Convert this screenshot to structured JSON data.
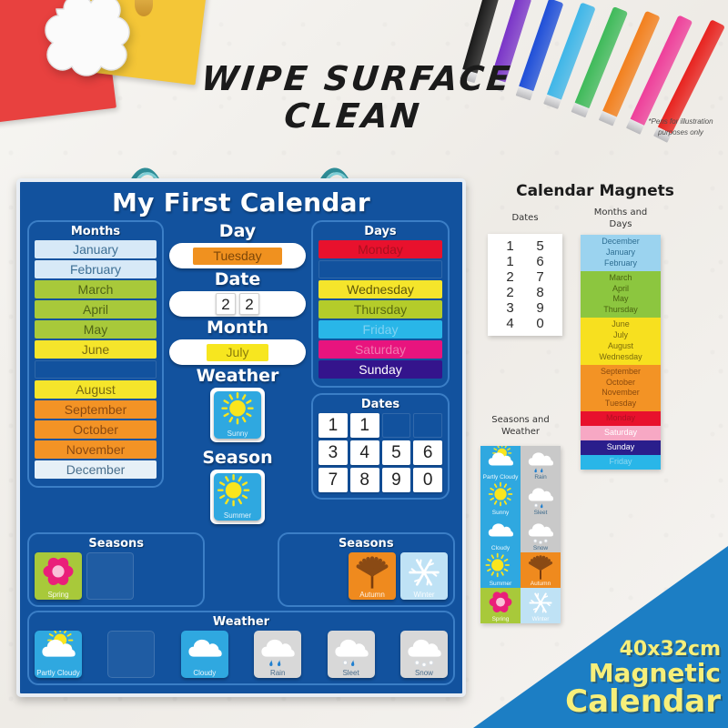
{
  "headline": {
    "line1": "WIPE SURFACE",
    "line2": "CLEAN"
  },
  "disclaimer": "*Pens for illustration purposes only",
  "pens": [
    {
      "name": "pen-black",
      "color": "#1a1a1a"
    },
    {
      "name": "pen-purple",
      "color": "#7a35c8"
    },
    {
      "name": "pen-blue",
      "color": "#1f4fd8"
    },
    {
      "name": "pen-cyan",
      "color": "#3fb6e8"
    },
    {
      "name": "pen-green",
      "color": "#3fba5a"
    },
    {
      "name": "pen-orange",
      "color": "#f2801e"
    },
    {
      "name": "pen-pink",
      "color": "#ee3f9a"
    },
    {
      "name": "pen-red",
      "color": "#e8231f"
    }
  ],
  "board": {
    "title": "My First Calendar",
    "months_panel": {
      "header": "Months",
      "tiles": [
        {
          "label": "January",
          "bg": "#d7e9f7",
          "fg": "#3e6f94"
        },
        {
          "label": "February",
          "bg": "#d7e9f7",
          "fg": "#3e6f94"
        },
        {
          "label": "March",
          "bg": "#a8c93a",
          "fg": "#4f6316"
        },
        {
          "label": "April",
          "bg": "#a8c93a",
          "fg": "#4f6316"
        },
        {
          "label": "May",
          "bg": "#a8c93a",
          "fg": "#4f6316"
        },
        {
          "label": "June",
          "bg": "#f5e52b",
          "fg": "#7a6b10"
        },
        {
          "label": "",
          "bg": "",
          "fg": ""
        },
        {
          "label": "August",
          "bg": "#f5e52b",
          "fg": "#7a6b10"
        },
        {
          "label": "September",
          "bg": "#f39325",
          "fg": "#8c4a10"
        },
        {
          "label": "October",
          "bg": "#f39325",
          "fg": "#8c4a10"
        },
        {
          "label": "November",
          "bg": "#f39325",
          "fg": "#8c4a10"
        },
        {
          "label": "December",
          "bg": "#e6f0f7",
          "fg": "#4a6f8c"
        }
      ]
    },
    "days_panel": {
      "header": "Days",
      "tiles": [
        {
          "label": "Monday",
          "bg": "#e8112d",
          "fg": "#a8101f"
        },
        {
          "label": "",
          "bg": "",
          "fg": ""
        },
        {
          "label": "Wednesday",
          "bg": "#f5e52b",
          "fg": "#5f5708"
        },
        {
          "label": "Thursday",
          "bg": "#b4cc2a",
          "fg": "#5a6a10"
        },
        {
          "label": "Friday",
          "bg": "#29b6e8",
          "fg": "#7fd2f2"
        },
        {
          "label": "Saturday",
          "bg": "#e8147e",
          "fg": "#f07ab0"
        },
        {
          "label": "Sunday",
          "bg": "#34148c",
          "fg": "#ffffff"
        }
      ]
    },
    "center": {
      "day_label": "Day",
      "day_value": "Tuesday",
      "day_bg": "#f0911f",
      "day_fg": "#7d4708",
      "date_label": "Date",
      "date_digits": [
        "2",
        "2"
      ],
      "month_label": "Month",
      "month_value": "July",
      "month_bg": "#f7e61f",
      "month_fg": "#8a7c0c",
      "weather_label": "Weather",
      "weather_value": "Sunny",
      "season_label": "Season",
      "season_value": "Summer"
    },
    "dates_panel": {
      "header": "Dates",
      "cells": [
        "1",
        "1",
        "",
        "",
        "3",
        "4",
        "5",
        "6",
        "7",
        "8",
        "9",
        "0"
      ]
    },
    "seasons_left": {
      "header": "Seasons",
      "tiles": [
        {
          "label": "Spring",
          "kind": "flower",
          "bg": "#a8c93a"
        },
        {
          "label": "",
          "kind": "empty",
          "bg": ""
        }
      ]
    },
    "seasons_right": {
      "header": "Seasons",
      "tiles": [
        {
          "label": "Autumn",
          "kind": "leaf",
          "bg": "#ef8a1e"
        },
        {
          "label": "Winter",
          "kind": "snowflake",
          "bg": "#bfe2f5"
        }
      ]
    },
    "weather_row": {
      "header": "Weather",
      "tiles": [
        {
          "label": "Partly Cloudy",
          "kind": "partly-cloudy",
          "bg": "#2fa8e0"
        },
        {
          "label": "",
          "kind": "empty",
          "bg": ""
        },
        {
          "label": "Cloudy",
          "kind": "cloudy",
          "bg": "#2fa8e0"
        },
        {
          "label": "Rain",
          "kind": "rain",
          "bg": "#d8d8d8"
        },
        {
          "label": "Sleet",
          "kind": "sleet",
          "bg": "#d8d8d8"
        },
        {
          "label": "Snow",
          "kind": "snow",
          "bg": "#d8d8d8"
        }
      ]
    }
  },
  "magnets": {
    "title": "Calendar Magnets",
    "dates_label": "Dates",
    "months_days_label": "Months and\nDays",
    "seasons_weather_label": "Seasons and\nWeather",
    "dates_digits": [
      "1",
      "5",
      "1",
      "6",
      "2",
      "7",
      "2",
      "8",
      "3",
      "9",
      "4",
      "0"
    ],
    "months_days_groups": [
      {
        "bg": "#9bd3ef",
        "fg": "#2f6f93",
        "items": [
          "December",
          "January",
          "February"
        ]
      },
      {
        "bg": "#8cc63f",
        "fg": "#4a6310",
        "items": [
          "March",
          "April",
          "May",
          "Thursday"
        ]
      },
      {
        "bg": "#f7e01f",
        "fg": "#7a6b0c",
        "items": [
          "June",
          "July",
          "August",
          "Wednesday"
        ]
      },
      {
        "bg": "#f39325",
        "fg": "#8a4a0e",
        "items": [
          "September",
          "October",
          "November",
          "Tuesday"
        ]
      },
      {
        "bg": "#e8112d",
        "fg": "#b01020",
        "items": [
          "Monday"
        ]
      },
      {
        "bg": "#f7a8c4",
        "fg": "#ffffff",
        "items": [
          "Saturday"
        ]
      },
      {
        "bg": "#2a1e8c",
        "fg": "#ffffff",
        "items": [
          "Sunday"
        ]
      },
      {
        "bg": "#29b6e8",
        "fg": "#8fd9f2",
        "items": [
          "Friday"
        ]
      }
    ],
    "seasons_weather_cells": [
      {
        "label": "Partly Cloudy",
        "kind": "partly-cloudy",
        "bg": "#2fa8e0"
      },
      {
        "label": "Rain",
        "kind": "rain",
        "bg": "#c9c9c9"
      },
      {
        "label": "Sunny",
        "kind": "sunny",
        "bg": "#2fa8e0"
      },
      {
        "label": "Sleet",
        "kind": "sleet",
        "bg": "#c9c9c9"
      },
      {
        "label": "Cloudy",
        "kind": "cloudy",
        "bg": "#2fa8e0"
      },
      {
        "label": "Snow",
        "kind": "snow",
        "bg": "#c9c9c9"
      },
      {
        "label": "Summer",
        "kind": "summer",
        "bg": "#2fa8e0"
      },
      {
        "label": "Autumn",
        "kind": "leaf",
        "bg": "#ef8a1e"
      },
      {
        "label": "Spring",
        "kind": "flower",
        "bg": "#a8c93a"
      },
      {
        "label": "Winter",
        "kind": "snowflake",
        "bg": "#bfe2f5"
      }
    ]
  },
  "promo": {
    "size": "40x32cm",
    "word1": "Magnetic",
    "word2": "Calendar"
  },
  "colors": {
    "board_blue": "#12529e",
    "panel_border": "#3b7ec6",
    "wedge_blue": "#1c7ec4",
    "promo_yellow": "#f7ef7a"
  }
}
